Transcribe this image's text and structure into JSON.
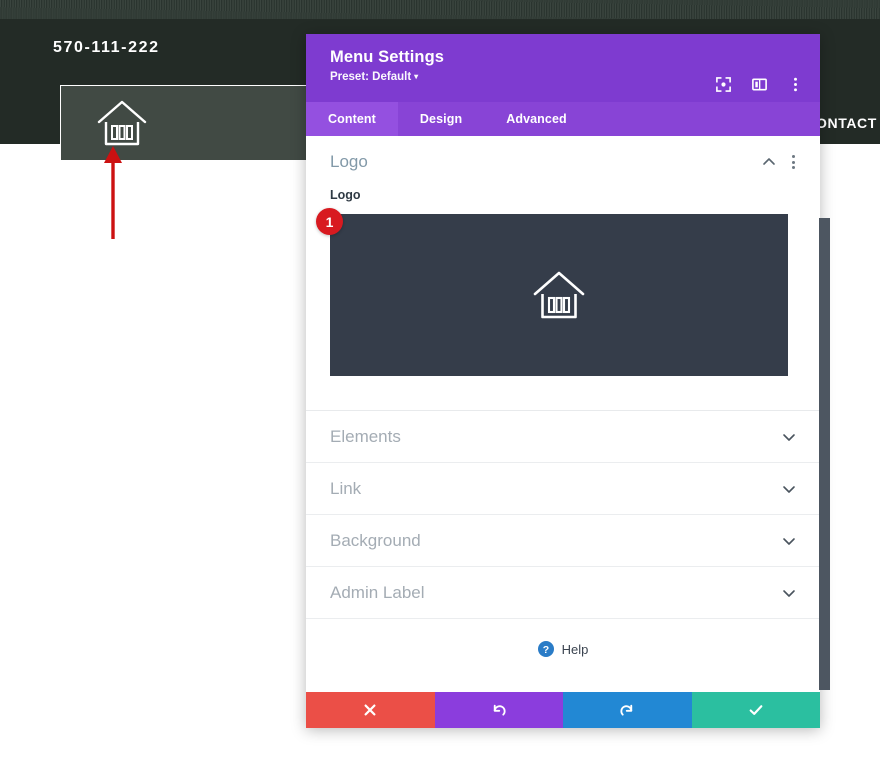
{
  "site": {
    "phone": "570-111-222",
    "logo_icon": "house-bank-icon",
    "nav_contact": "ONTACT"
  },
  "annotation": {
    "arrow": "red-up-arrow",
    "badge_number": "1"
  },
  "modal": {
    "title": "Menu Settings",
    "preset": "Preset: Default",
    "preset_caret": "▾",
    "header_icons": [
      {
        "name": "focus-target-icon"
      },
      {
        "name": "split-view-icon"
      },
      {
        "name": "more-options-icon"
      }
    ],
    "tabs": [
      {
        "label": "Content",
        "active": true
      },
      {
        "label": "Design",
        "active": false
      },
      {
        "label": "Advanced",
        "active": false
      }
    ],
    "open_section": {
      "title": "Logo",
      "collapse_icon": "chevron-up-icon",
      "options_icon": "more-options-icon",
      "field_label": "Logo",
      "preview_icon": "house-bank-icon"
    },
    "accordions": [
      {
        "label": "Elements",
        "icon": "chevron-down-icon"
      },
      {
        "label": "Link",
        "icon": "chevron-down-icon"
      },
      {
        "label": "Background",
        "icon": "chevron-down-icon"
      },
      {
        "label": "Admin Label",
        "icon": "chevron-down-icon"
      }
    ],
    "help": {
      "label": "Help",
      "icon": "help-question-icon"
    },
    "footer_buttons": [
      {
        "name": "cancel-button",
        "icon": "close-x-icon"
      },
      {
        "name": "undo-button",
        "icon": "undo-arrow-icon"
      },
      {
        "name": "redo-button",
        "icon": "redo-arrow-icon"
      },
      {
        "name": "save-button",
        "icon": "checkmark-icon"
      }
    ]
  },
  "colors": {
    "modal_header_purple": "#7e3bd0",
    "tabbar_purple": "#8844d6",
    "tab_active_purple": "#9450e0",
    "preview_dark": "#353d4a",
    "badge_red": "#d81a20",
    "cancel_red": "#eb4f47",
    "undo_purple": "#8b3ddd",
    "redo_blue": "#2288d4",
    "save_teal": "#2bbfa0",
    "site_dark": "#232b26",
    "site_box": "#414a44",
    "arrow_red": "#cc1111"
  }
}
